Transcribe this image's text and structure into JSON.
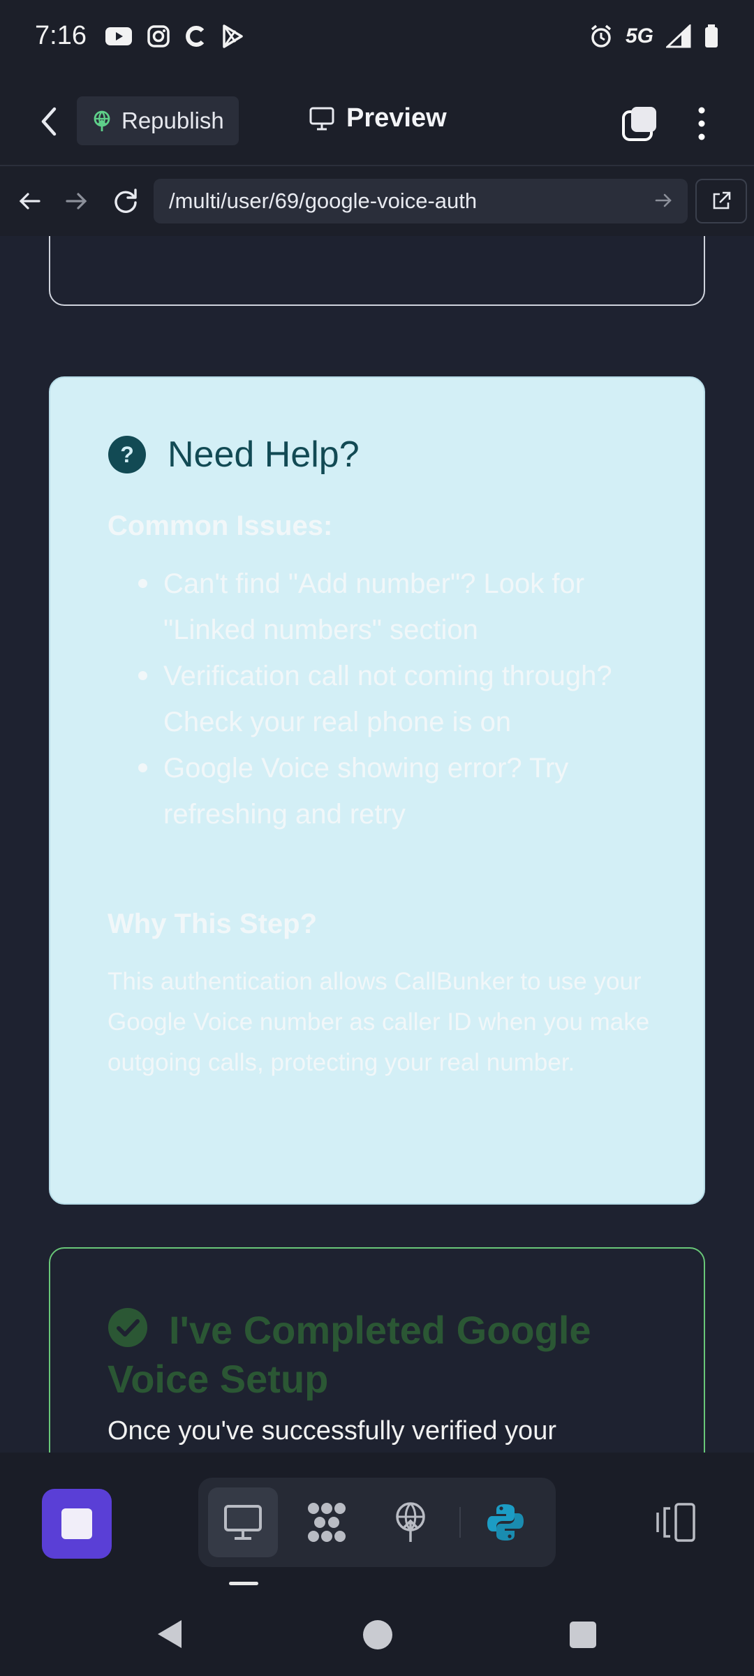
{
  "status_bar": {
    "time": "7:16",
    "network": "5G"
  },
  "topbar": {
    "republish_label": "Republish",
    "preview_label": "Preview"
  },
  "urlbar": {
    "url": "/multi/user/69/google-voice-auth"
  },
  "help_card": {
    "title": "Need Help?",
    "common_heading": "Common Issues:",
    "issues": [
      "Can't find \"Add number\"? Look for \"Linked numbers\" section",
      "Verification call not coming through? Check your real phone is on",
      "Google Voice showing error? Try refreshing and retry"
    ],
    "why_heading": "Why This Step?",
    "why_text": "This authentication allows CallBunker to use your Google Voice number as caller ID when you make outgoing calls, protecting your real number."
  },
  "done_card": {
    "title": "I've Completed Google Voice Setup",
    "body_partial": "Once you've successfully verified your"
  },
  "colors": {
    "accent": "#5a3fd6",
    "help_bg": "#d3eff6",
    "success": "#69c778",
    "help_icon": "#124a54"
  },
  "icons": [
    "youtube-icon",
    "instagram-icon",
    "c-app-icon",
    "play-store-icon",
    "alarm-icon",
    "signal-icon",
    "battery-icon",
    "python-icon"
  ]
}
